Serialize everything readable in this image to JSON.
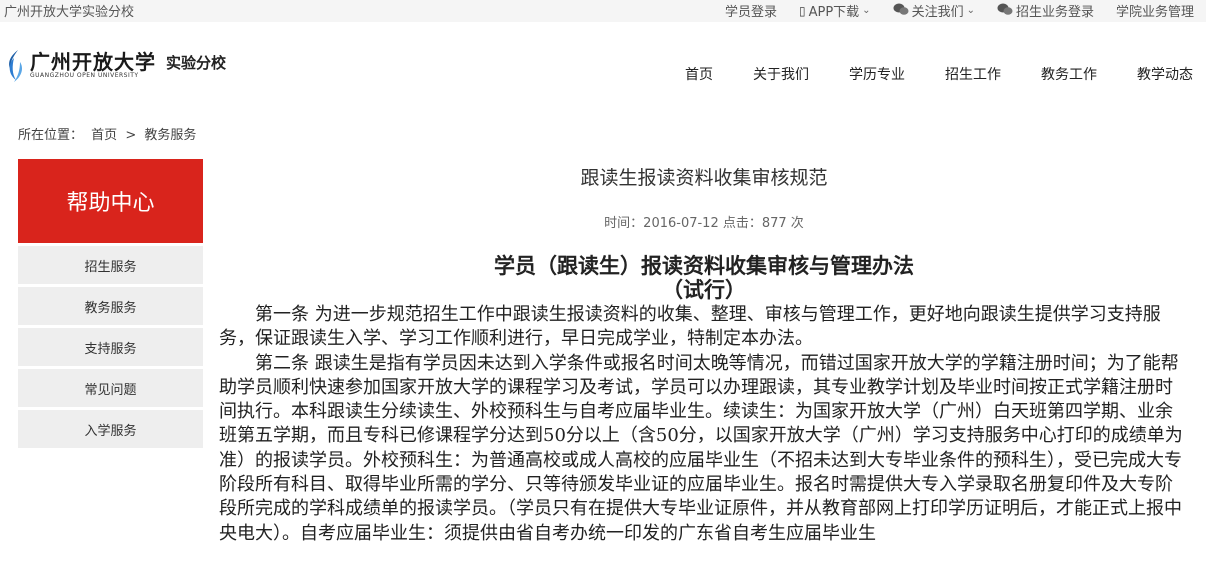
{
  "topbar": {
    "site_name": "广州开放大学实验分校",
    "links": [
      {
        "label": "学员登录",
        "icon": "",
        "chevron": false
      },
      {
        "label": "APP下载",
        "icon": "phone-icon",
        "chevron": true
      },
      {
        "label": "关注我们",
        "icon": "wechat-icon",
        "chevron": true
      },
      {
        "label": "招生业务登录",
        "icon": "wechat-icon",
        "chevron": false
      },
      {
        "label": "学院业务管理",
        "icon": "",
        "chevron": false
      }
    ]
  },
  "logo": {
    "cn": "广州开放大学",
    "en": "GUANGZHOU OPEN UNIVERSITY",
    "suffix": "实验分校"
  },
  "nav": [
    "首页",
    "关于我们",
    "学历专业",
    "招生工作",
    "教务工作",
    "教学动态"
  ],
  "breadcrumb": {
    "prefix": "所在位置：",
    "home": "首页",
    "sep": ">",
    "current": "教务服务"
  },
  "sidebar": {
    "title": "帮助中心",
    "items": [
      "招生服务",
      "教务服务",
      "支持服务",
      "常见问题",
      "入学服务"
    ],
    "accent": "#d9241c"
  },
  "article": {
    "title": "跟读生报读资料收集审核规范",
    "meta": "时间：2016-07-12 点击：877 次",
    "heading": "学员（跟读生）报读资料收集审核与管理办法",
    "subheading": "（试行）",
    "paragraphs": [
      "第一条 为进一步规范招生工作中跟读生报读资料的收集、整理、审核与管理工作，更好地向跟读生提供学习支持服务，保证跟读生入学、学习工作顺利进行，早日完成学业，特制定本办法。",
      "第二条 跟读生是指有学员因未达到入学条件或报名时间太晚等情况，而错过国家开放大学的学籍注册时间；为了能帮助学员顺利快速参加国家开放大学的课程学习及考试，学员可以办理跟读，其专业教学计划及毕业时间按正式学籍注册时间执行。本科跟读生分续读生、外校预科生与自考应届毕业生。续读生：为国家开放大学（广州）白天班第四学期、业余班第五学期，而且专科已修课程学分达到50分以上（含50分，以国家开放大学（广州）学习支持服务中心打印的成绩单为准）的报读学员。外校预科生：为普通高校或成人高校的应届毕业生（不招未达到大专毕业条件的预科生），受已完成大专阶段所有科目、取得毕业所需的学分、只等待颁发毕业证的应届毕业生。报名时需提供大专入学录取名册复印件及大专阶段所完成的学科成绩单的报读学员。（学员只有在提供大专毕业证原件，并从教育部网上打印学历证明后，才能正式上报中央电大）。自考应届毕业生：须提供由省自考办统一印发的广东省自考生应届毕业生"
    ]
  }
}
